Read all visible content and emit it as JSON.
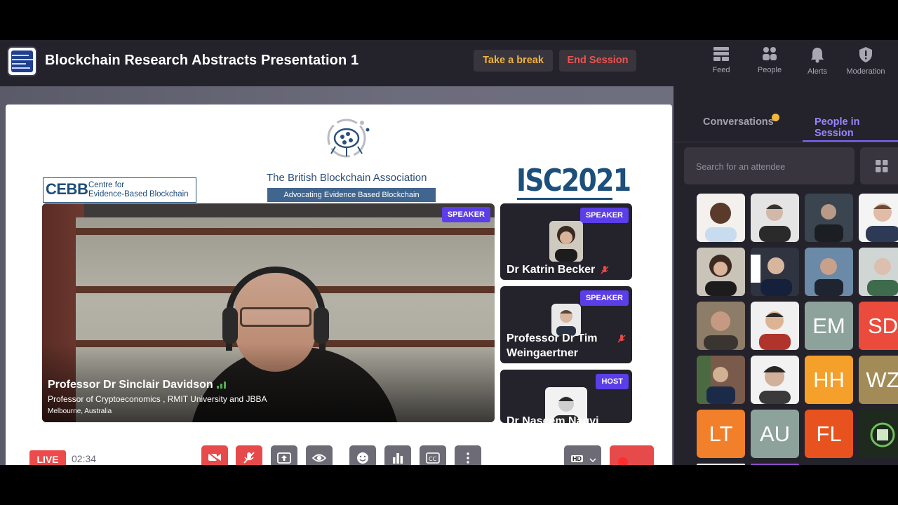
{
  "header": {
    "title": "Blockchain Research Abstracts Presentation 1",
    "take_break_label": "Take a break",
    "end_session_label": "End Session",
    "nav": [
      {
        "label": "Feed",
        "icon": "feed-icon"
      },
      {
        "label": "People",
        "icon": "people-icon"
      },
      {
        "label": "Alerts",
        "icon": "bell-icon"
      },
      {
        "label": "Moderation",
        "icon": "shield-icon"
      }
    ]
  },
  "slide": {
    "cebb_mark": "CEBB",
    "cebb_line1": "Centre for",
    "cebb_line2": "Evidence-Based Blockchain",
    "bba_name": "The British Blockchain Association",
    "bba_tagline": "Advocating Evidence Based Blockchain",
    "conference": "ISC2021"
  },
  "main_speaker": {
    "tag": "SPEAKER",
    "name": "Professor Dr Sinclair Davidson",
    "role": "Professor of Cryptoeconomics , RMIT University and JBBA",
    "location": "Melbourne, Australia"
  },
  "side_tiles": [
    {
      "tag": "SPEAKER",
      "name_line1": "Dr Katrin Becker",
      "name_line2": ""
    },
    {
      "tag": "SPEAKER",
      "name_line1": "Professor Dr Tim",
      "name_line2": "Weingaertner"
    },
    {
      "tag": "HOST",
      "name_line1": "Dr Naseem Naqvi",
      "name_line2": ""
    }
  ],
  "controls": {
    "live_label": "LIVE",
    "timer": "02:34",
    "quality_label": "HD"
  },
  "panel": {
    "tab_conversations": "Conversations",
    "tab_people": "People in Session",
    "search_placeholder": "Search for an attendee",
    "initials": [
      "EM",
      "SD",
      "HH",
      "WZ",
      "LT",
      "AU",
      "FL"
    ]
  },
  "colors": {
    "accent": "#7c66ff",
    "tag_bg": "#5b3ee8",
    "live": "#ec4b4b",
    "break": "#f3b33d",
    "end": "#f0524f"
  }
}
